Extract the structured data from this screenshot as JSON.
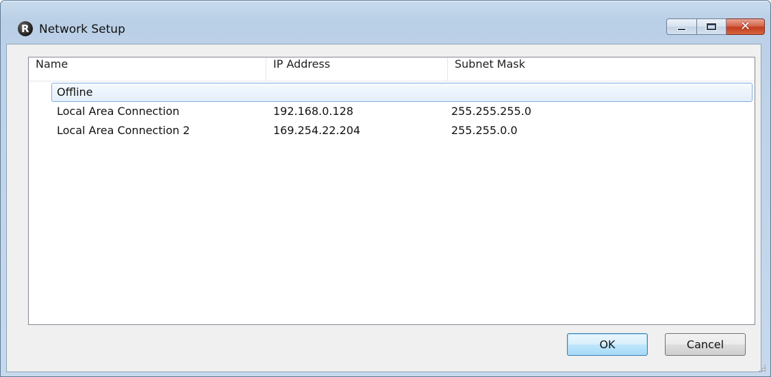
{
  "window": {
    "title": "Network Setup",
    "icon": "r-logo-icon",
    "controls": [
      "minimize-icon",
      "maximize-icon",
      "close-icon"
    ]
  },
  "table": {
    "columns": [
      "Name",
      "IP Address",
      "Subnet Mask"
    ],
    "selected_row": {
      "name": "Offline"
    },
    "rows": [
      {
        "name": "Local Area Connection",
        "ip": "192.168.0.128",
        "mask": "255.255.255.0"
      },
      {
        "name": "Local Area Connection 2",
        "ip": "169.254.22.204",
        "mask": "255.255.0.0"
      }
    ]
  },
  "buttons": {
    "ok": "OK",
    "cancel": "Cancel"
  },
  "colors": {
    "selection_border": "#84acdd",
    "close_button": "#c33d1f"
  }
}
